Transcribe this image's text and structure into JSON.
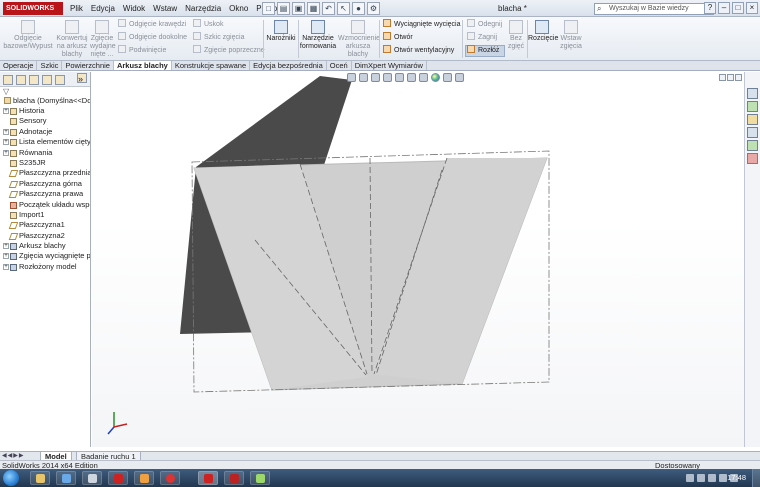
{
  "app": {
    "logo": "SOLIDWORKS",
    "menu": [
      "Plik",
      "Edycja",
      "Widok",
      "Wstaw",
      "Narzędzia",
      "Okno",
      "Pomoc"
    ],
    "doc_title": "blacha *",
    "search_placeholder": "Wyszukaj w Bazie wiedzy"
  },
  "ribbon": {
    "big_buttons": [
      {
        "label": "Odgięcie bazowe/Wypust",
        "enabled": false
      },
      {
        "label": "Konwertuj na arkusz blachy",
        "enabled": false
      },
      {
        "label": "Zgięcie wydajne nięte ...",
        "enabled": false
      },
      {
        "label": "Narożniki",
        "enabled": true
      },
      {
        "label": "Narzędzie formowania",
        "enabled": true
      },
      {
        "label": "Wzmocnienie arkusza blachy",
        "enabled": false
      },
      {
        "label": "Odegnij",
        "enabled": false
      },
      {
        "label": "Zagnij",
        "enabled": false
      },
      {
        "label": "Bez zgięć",
        "enabled": false
      },
      {
        "label": "Rozcięcie",
        "enabled": true
      },
      {
        "label": "Wstaw zgięcia",
        "enabled": false
      }
    ],
    "small_col1": [
      {
        "label": "Odgięcie krawędzi",
        "enabled": false
      },
      {
        "label": "Odgięcie dookolne",
        "enabled": false
      },
      {
        "label": "Podwinięcie",
        "enabled": false
      }
    ],
    "small_col2": [
      {
        "label": "Uskok",
        "enabled": false
      },
      {
        "label": "Szkic zgięcia",
        "enabled": false
      },
      {
        "label": "Zgięcie poprzeczne",
        "enabled": false
      }
    ],
    "small_col3": [
      {
        "label": "Wyciągnięte wycięcia",
        "enabled": true
      },
      {
        "label": "Otwór",
        "enabled": true
      },
      {
        "label": "Otwór wentylacyjny",
        "enabled": true
      }
    ],
    "rozloz": "Rozłóż"
  },
  "tabs": [
    {
      "label": "Operacje",
      "active": false
    },
    {
      "label": "Szkic",
      "active": false
    },
    {
      "label": "Powierzchnie",
      "active": false
    },
    {
      "label": "Arkusz blachy",
      "active": true
    },
    {
      "label": "Konstrukcje spawane",
      "active": false
    },
    {
      "label": "Edycja bezpośrednia",
      "active": false
    },
    {
      "label": "Oceń",
      "active": false
    },
    {
      "label": "DimXpert Wymiarów",
      "active": false
    }
  ],
  "feature_tree": {
    "root": "blacha  (Domyślna<<Do",
    "items": [
      {
        "label": "Historia",
        "expand": true,
        "icon": "folder"
      },
      {
        "label": "Sensory",
        "expand": false,
        "icon": "folder"
      },
      {
        "label": "Adnotacje",
        "expand": true,
        "icon": "folder"
      },
      {
        "label": "Lista elementów cięty",
        "expand": true,
        "icon": "folder"
      },
      {
        "label": "Równania",
        "expand": true,
        "icon": "folder"
      },
      {
        "label": "S235JR",
        "expand": false,
        "icon": "folder"
      },
      {
        "label": "Płaszczyzna przednia",
        "expand": false,
        "icon": "plane"
      },
      {
        "label": "Płaszczyzna górna",
        "expand": false,
        "icon": "plane"
      },
      {
        "label": "Płaszczyzna prawa",
        "expand": false,
        "icon": "plane"
      },
      {
        "label": "Początek układu współ",
        "expand": false,
        "icon": "red"
      },
      {
        "label": "Import1",
        "expand": false,
        "icon": "folder"
      },
      {
        "label": "Płaszczyzna1",
        "expand": false,
        "icon": "plane"
      },
      {
        "label": "Płaszczyzna2",
        "expand": false,
        "icon": "plane"
      },
      {
        "label": "Arkusz blachy",
        "expand": true,
        "icon": "sheet"
      },
      {
        "label": "Zgięcia wyciągnięte p",
        "expand": true,
        "icon": "sheet"
      },
      {
        "label": "Rozłożony model",
        "expand": true,
        "icon": "sheet"
      }
    ]
  },
  "bottom_tabs": [
    {
      "label": "Model",
      "active": true
    },
    {
      "label": "Badanie ruchu 1",
      "active": false
    }
  ],
  "status": {
    "left": "SolidWorks 2014 x64 Edition",
    "right": "Dostosowany"
  },
  "clock": "17:48",
  "colors": {
    "brand": "#b8141a",
    "part_face": "#cfcfcf",
    "shadow": "#4a4a4a",
    "taskbar": "#21364f"
  }
}
